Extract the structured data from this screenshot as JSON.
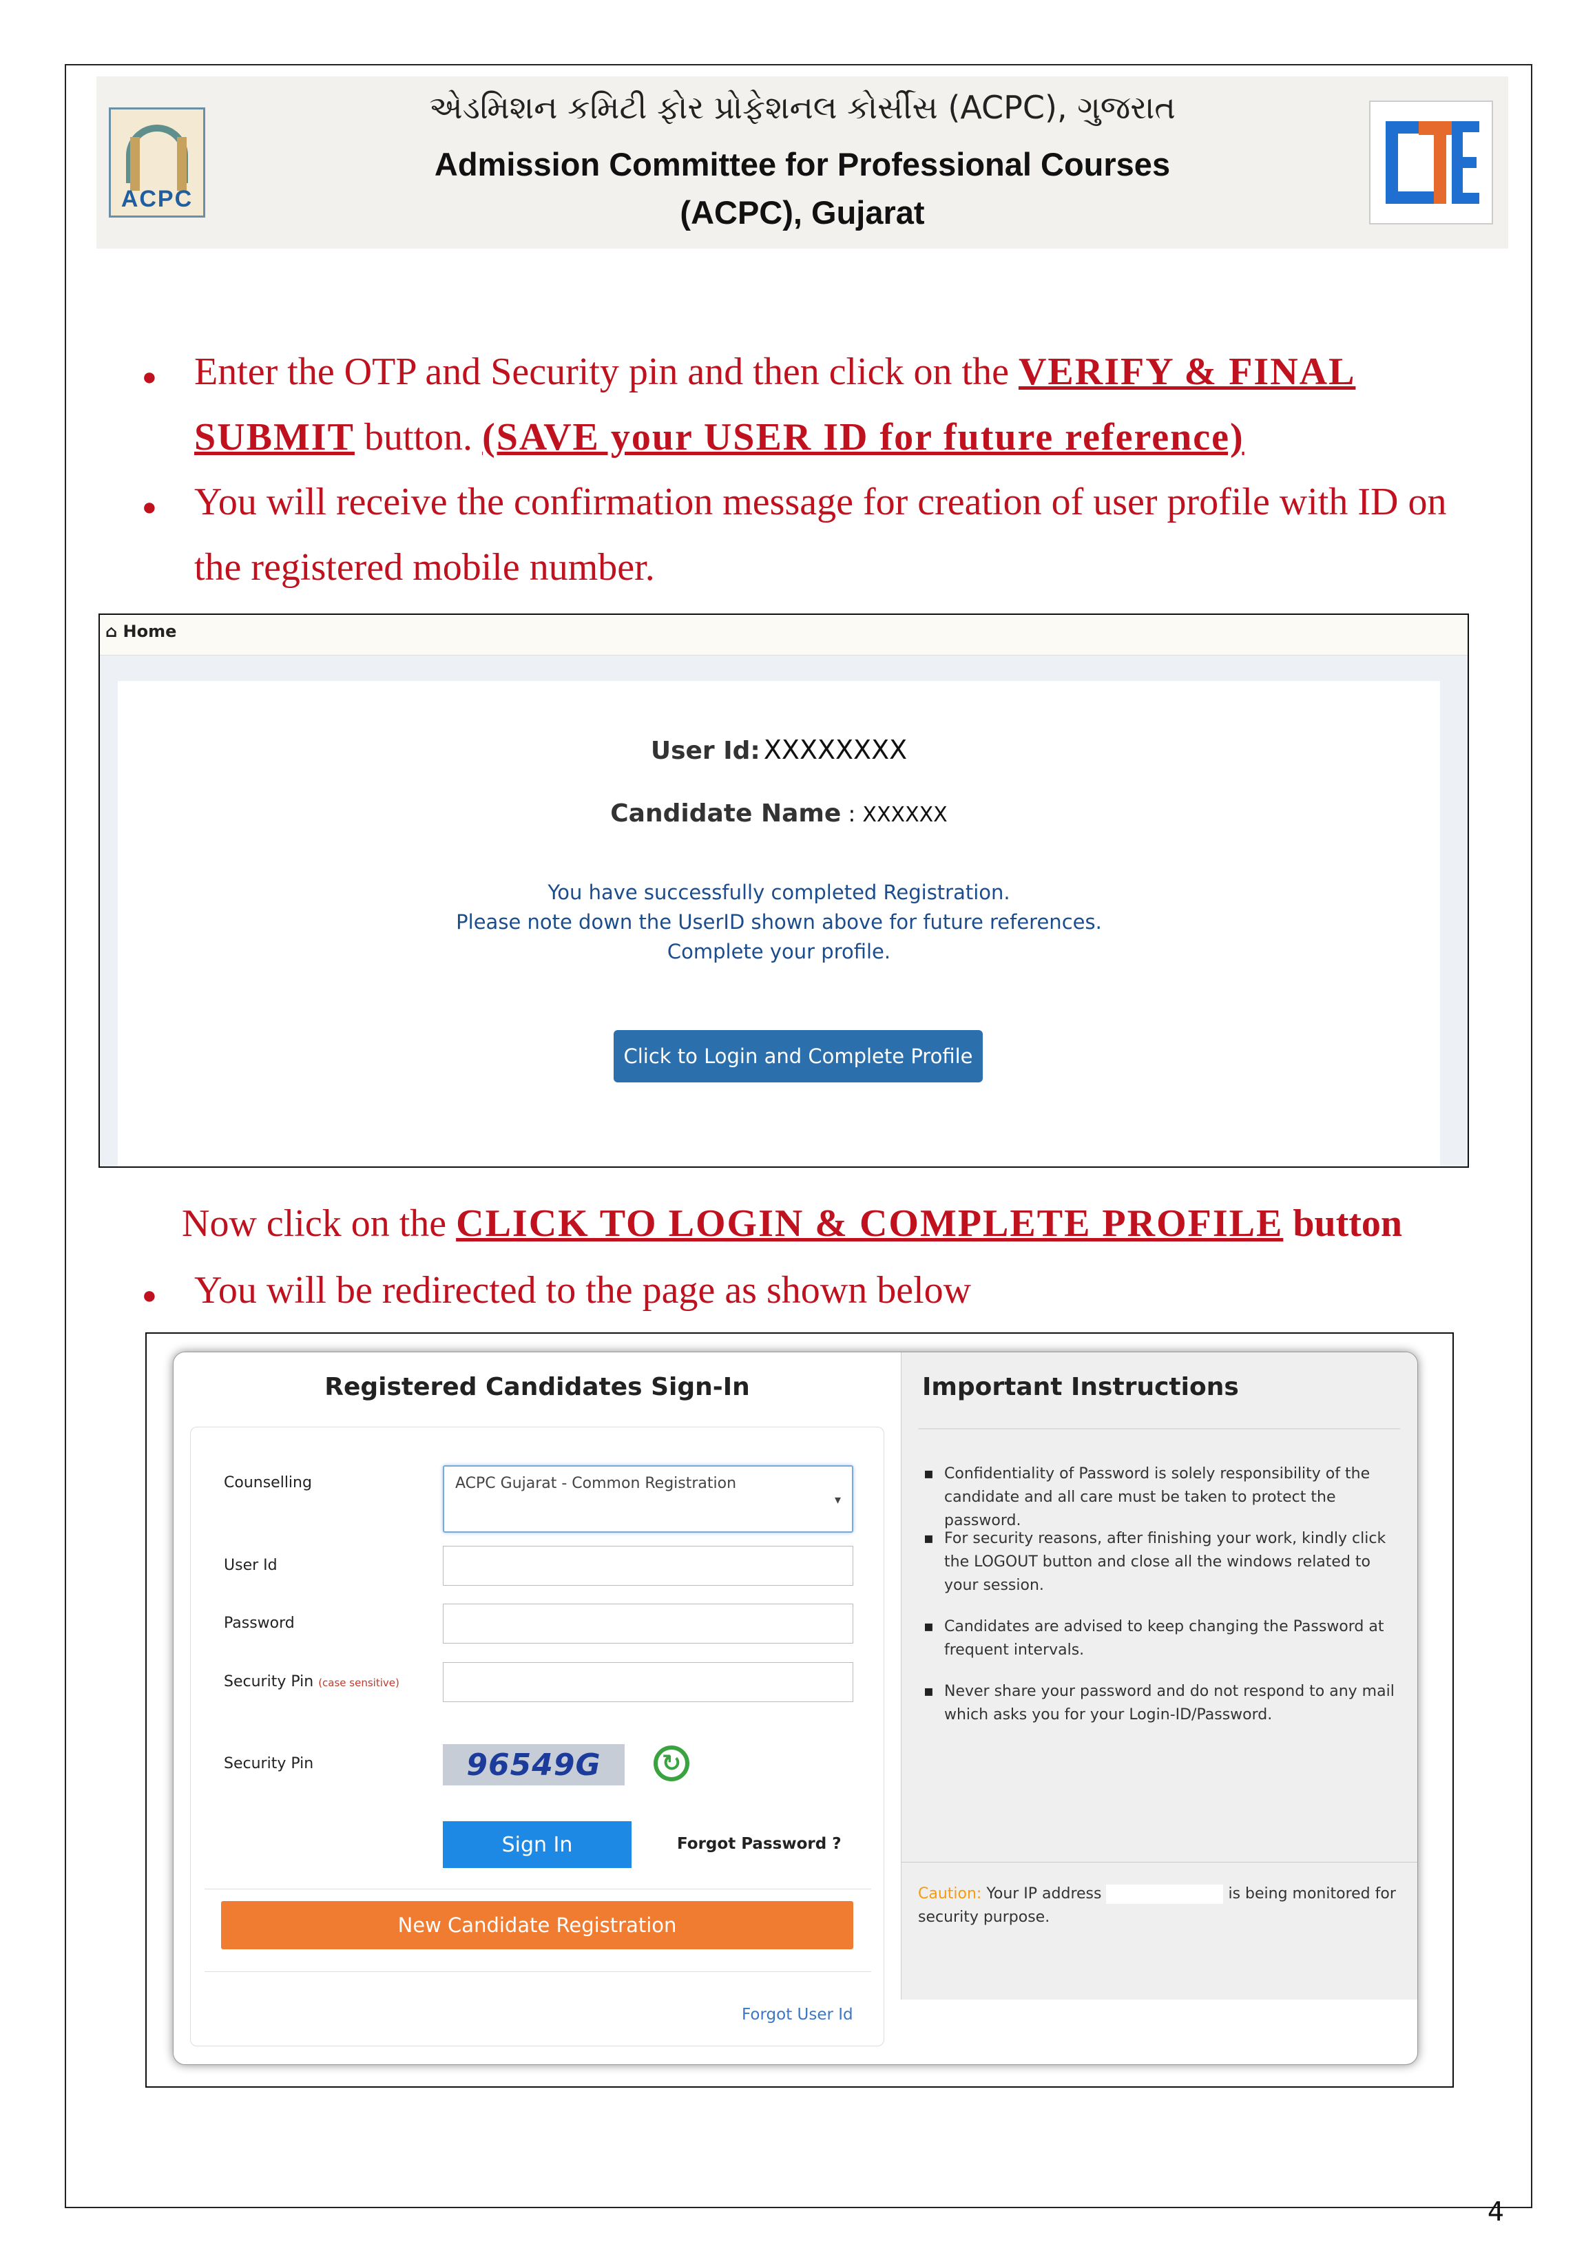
{
  "header": {
    "gujarati_title": "એડમિશન કમિટી ફોર પ્રોફેશનલ કોર્સીસ (ACPC), ગુજરાત",
    "english_title_line1": "Admission Committee for Professional Courses",
    "english_title_line2": "(ACPC), Gujarat",
    "left_logo_text": "ACPC"
  },
  "instructions": {
    "b1_p1": "Enter the OTP and Security pin and then click on the ",
    "b1_p2": "VERIFY & FINAL",
    "b1_p3": "SUBMIT",
    "b1_p4": " button. ",
    "b1_p5": "(SAVE your USER ID for future reference)",
    "b2_l1": "You will receive the confirmation message for creation of user profile with ID on",
    "b2_l2": "the registered mobile number.",
    "step_p1": "Now click on the ",
    "step_p2": "CLICK TO LOGIN & COMPLETE PROFILE",
    "step_p3": " button",
    "b3": "You will be redirected to the page as shown below"
  },
  "screenshot1": {
    "breadcrumb": "Home",
    "user_id_label": "User Id:",
    "user_id_value": "XXXXXXXX",
    "candidate_label": "Candidate Name",
    "candidate_sep": " : ",
    "candidate_value": "XXXXXX",
    "msg1": "You have successfully completed Registration.",
    "msg2": "Please note down the UserID shown above for future references.",
    "msg3": "Complete your profile.",
    "button": "Click to Login and Complete Profile"
  },
  "screenshot2": {
    "title": "Registered Candidates Sign-In",
    "counselling_label": "Counselling",
    "counselling_value": "ACPC Gujarat - Common Registration",
    "userid_label": "User Id",
    "password_label": "Password",
    "security_pin_label": "Security Pin",
    "case_note": "(case sensitive)",
    "security_pin_label2": "Security Pin",
    "captcha": "96549G",
    "sign_in": "Sign In",
    "forgot_password": "Forgot Password ?",
    "new_registration": "New Candidate Registration",
    "forgot_userid": "Forgot User Id",
    "instructions_title": "Important Instructions",
    "instructions": [
      "Confidentiality of Password is solely responsibility of the candidate and all care must be taken to protect the password.",
      "For security reasons, after finishing your work, kindly click the LOGOUT button and close all the windows related to your session.",
      "Candidates are advised to keep changing the Password at frequent intervals.",
      "Never share your password and do not respond to any mail which asks you for your Login-ID/Password."
    ],
    "caution_label": "Caution:",
    "caution_p1": " Your IP address ",
    "caution_p2": " is being monitored for security purpose."
  },
  "page_number": "4"
}
